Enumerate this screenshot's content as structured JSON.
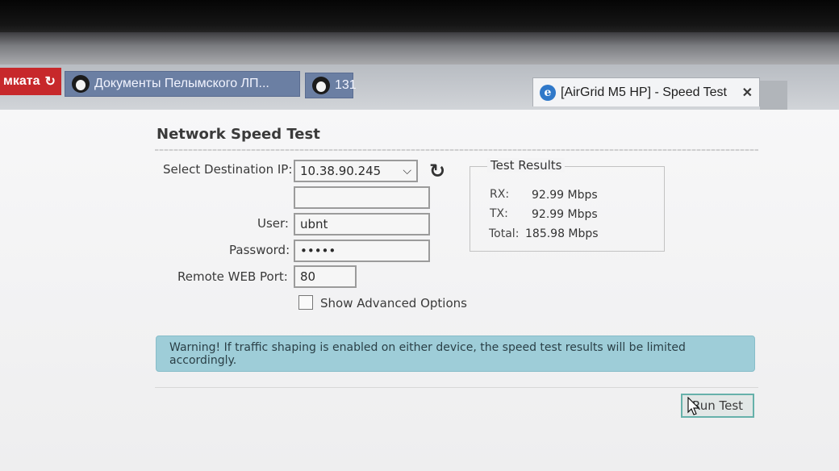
{
  "tabs": {
    "red_tab": {
      "label": "мката"
    },
    "docs_tab": {
      "label": "Документы Пелымского ЛП..."
    },
    "tab_131": {
      "label": "131"
    },
    "active_tab": {
      "label": "[AirGrid M5 HP] - Speed Test"
    }
  },
  "page": {
    "heading": "Network Speed Test"
  },
  "form": {
    "destination_label": "Select Destination IP:",
    "destination_value": "10.38.90.245",
    "extra_field_value": "",
    "user_label": "User:",
    "user_value": "ubnt",
    "password_label": "Password:",
    "password_value": "•••••",
    "port_label": "Remote WEB Port:",
    "port_value": "80",
    "advanced_label": "Show Advanced Options"
  },
  "results": {
    "title": "Test Results",
    "rx_label": "RX:",
    "rx_value": "92.99 Mbps",
    "tx_label": "TX:",
    "tx_value": "92.99 Mbps",
    "total_label": "Total:",
    "total_value": "185.98 Mbps"
  },
  "warning": {
    "text": "Warning! If traffic shaping is enabled on either device, the speed test results will be limited accordingly."
  },
  "actions": {
    "run_label": "Run Test"
  },
  "icons": {
    "refresh": "refresh-icon",
    "close": "close-icon",
    "chevron": "chevron-down-icon"
  },
  "colors": {
    "warning_bg": "#9ecdd8",
    "run_border": "#66b1aa",
    "red_tab": "#c7282b"
  }
}
